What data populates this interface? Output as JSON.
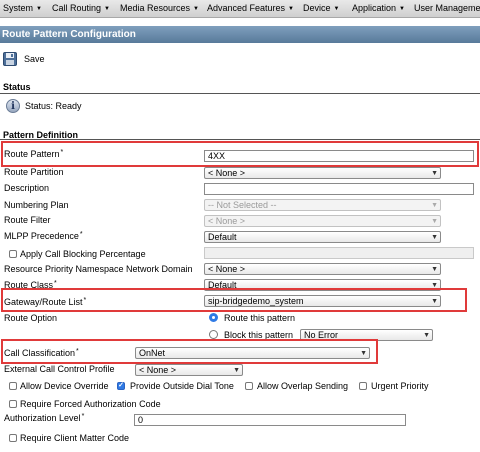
{
  "menubar": {
    "items": [
      {
        "label": "System"
      },
      {
        "label": "Call Routing"
      },
      {
        "label": "Media Resources"
      },
      {
        "label": "Advanced Features"
      },
      {
        "label": "Device"
      },
      {
        "label": "Application"
      },
      {
        "label": "User Managemen"
      }
    ]
  },
  "page": {
    "title": "Route Pattern Configuration"
  },
  "toolbar": {
    "save_label": "Save"
  },
  "status": {
    "section_title": "Status",
    "text": "Status: Ready"
  },
  "pattern": {
    "section_title": "Pattern Definition",
    "route_pattern": {
      "label": "Route Pattern",
      "required": "*",
      "value": "4XX"
    },
    "route_partition": {
      "label": "Route Partition",
      "value": "< None >"
    },
    "description": {
      "label": "Description",
      "value": ""
    },
    "numbering_plan": {
      "label": "Numbering Plan",
      "value": "-- Not Selected --"
    },
    "route_filter": {
      "label": "Route Filter",
      "value": "< None >"
    },
    "mlpp_precedence": {
      "label": "MLPP Precedence",
      "required": "*",
      "value": "Default"
    },
    "apply_call_blocking": {
      "label": "Apply Call Blocking Percentage",
      "checked": false,
      "value": ""
    },
    "resource_priority": {
      "label": "Resource Priority Namespace Network Domain",
      "value": "< None >"
    },
    "route_class": {
      "label": "Route Class",
      "required": "*",
      "value": "Default"
    },
    "gateway_route_list": {
      "label": "Gateway/Route List",
      "required": "*",
      "value": "sip-bridgedemo_system"
    },
    "route_option": {
      "label": "Route Option",
      "route_this_pattern": "Route this pattern",
      "block_this_pattern": "Block this pattern",
      "block_reason": "No Error"
    },
    "call_classification": {
      "label": "Call Classification",
      "required": "*",
      "value": "OnNet"
    },
    "external_call_control": {
      "label": "External Call Control Profile",
      "value": "< None >"
    },
    "checkboxes": {
      "allow_device_override": "Allow Device Override",
      "provide_outside_dial_tone": "Provide Outside Dial Tone",
      "allow_overlap_sending": "Allow Overlap Sending",
      "urgent_priority": "Urgent Priority",
      "require_forced_auth": "Require Forced Authorization Code",
      "require_client_matter": "Require Client Matter Code"
    },
    "authorization_level": {
      "label": "Authorization Level",
      "required": "*",
      "value": "0"
    }
  },
  "colors": {
    "highlight": "#e03a3a",
    "title_bar": "#6a8bab",
    "checkbox_on": "#2f7ae5"
  }
}
